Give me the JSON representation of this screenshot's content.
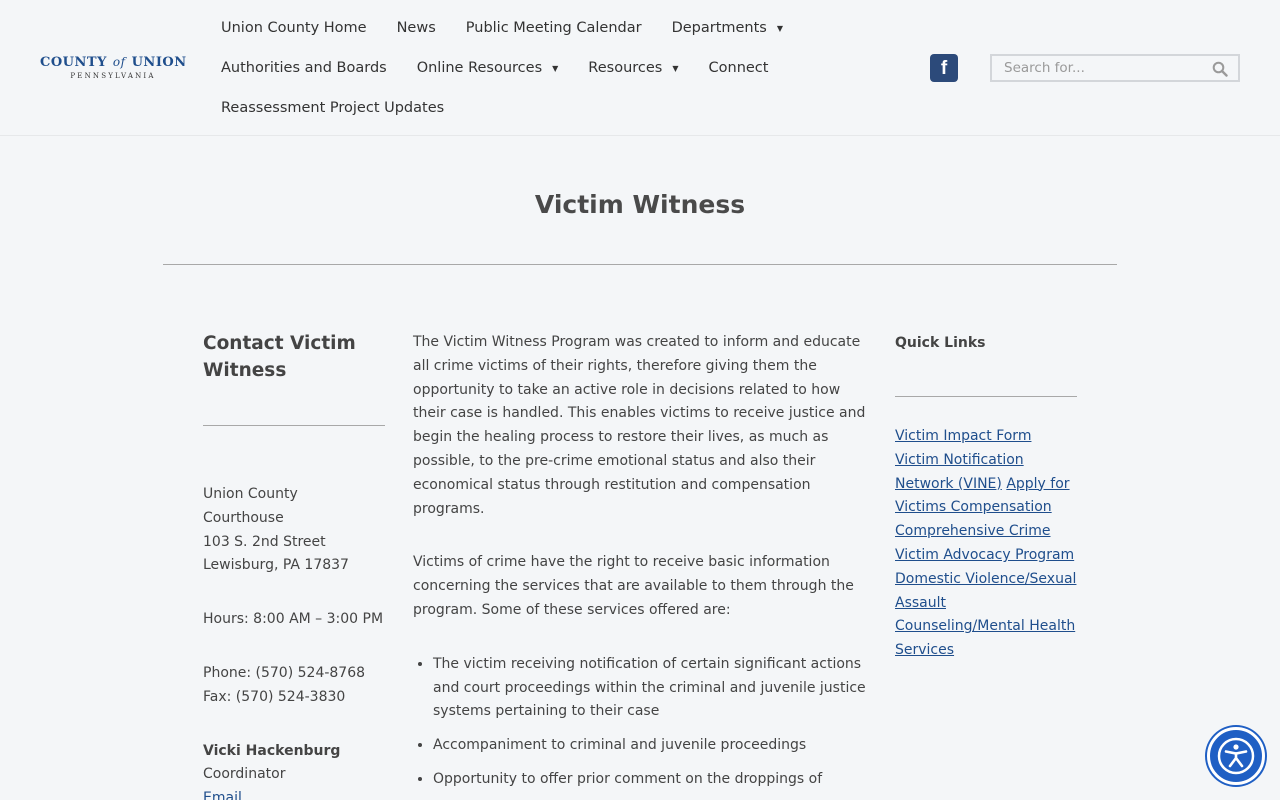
{
  "logo": {
    "main_left": "County",
    "main_of": "of",
    "main_right": "Union",
    "sub": "PENNSYLVANIA"
  },
  "nav": {
    "row1": [
      {
        "label": "Union County Home",
        "dropdown": false
      },
      {
        "label": "News",
        "dropdown": false
      },
      {
        "label": "Public Meeting Calendar",
        "dropdown": false
      },
      {
        "label": "Departments",
        "dropdown": true
      }
    ],
    "row2": [
      {
        "label": "Authorities and Boards",
        "dropdown": false
      },
      {
        "label": "Online Resources",
        "dropdown": true
      },
      {
        "label": "Resources",
        "dropdown": true
      },
      {
        "label": "Connect",
        "dropdown": false
      }
    ],
    "row3": [
      {
        "label": "Reassessment Project Updates",
        "dropdown": false
      }
    ],
    "caret": "▼"
  },
  "social": {
    "facebook_glyph": "f",
    "icon": "facebook-icon",
    "color": "#2c4a7a"
  },
  "search": {
    "placeholder": "Search for...",
    "value": ""
  },
  "page": {
    "title": "Victim Witness"
  },
  "contact": {
    "heading": "Contact Victim Witness",
    "address": [
      "Union County",
      "Courthouse",
      "103 S. 2nd Street",
      "Lewisburg, PA 17837"
    ],
    "hours": "Hours: 8:00 AM – 3:00 PM",
    "phone": "Phone: (570) 524-8768",
    "fax": "Fax: (570) 524-3830",
    "person_name": "Vicki Hackenburg",
    "person_title": "Coordinator",
    "email_label": "Email"
  },
  "main": {
    "paragraph1": "The Victim Witness Program was created to inform and educate all crime victims of their rights, therefore giving them the opportunity to take an active role in decisions related to how their case is handled. This enables victims to receive justice and begin the healing process to restore their lives, as much as possible, to the pre-crime emotional status and also their economical status through restitution and compensation programs.",
    "paragraph2": "Victims of crime have the right to receive basic information concerning the services that are available to them through the program. Some of these services offered are:",
    "services": [
      "The victim receiving notification of certain significant actions and court proceedings within the criminal and juvenile justice systems pertaining to their case",
      "Accompaniment to criminal and juvenile proceedings",
      "Opportunity to offer prior comment on the droppings of"
    ]
  },
  "quick_links": {
    "heading": "Quick Links",
    "links": [
      {
        "label": "Victim Impact Form"
      },
      {
        "label": "Victim Notification Network (VINE)"
      },
      {
        "label": "Apply for Victims Compensation"
      },
      {
        "label": "Comprehensive Crime Victim Advocacy Program"
      },
      {
        "label": "Domestic Violence/Sexual Assault Counseling/Mental Health Services"
      }
    ]
  },
  "colors": {
    "link": "#1f4e8c",
    "accent": "#1f5fc4",
    "background": "#f4f6f8"
  },
  "accessibility": {
    "icon": "accessibility-icon"
  }
}
